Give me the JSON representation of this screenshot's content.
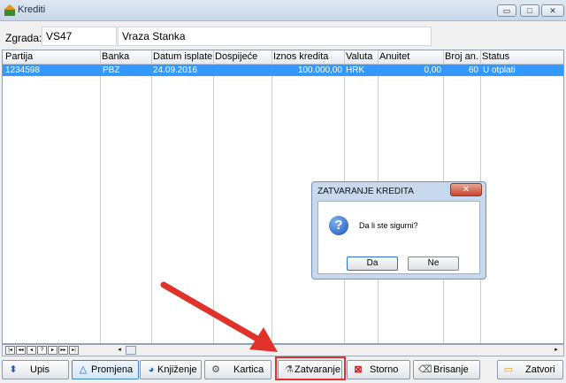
{
  "window": {
    "title": "Krediti",
    "minimize_symbol": "▭",
    "maximize_symbol": "□",
    "close_symbol": "✕"
  },
  "header": {
    "label": "Zgrada:",
    "code": "VS47",
    "name": "Vraza Stanka"
  },
  "grid": {
    "columns": [
      "Partija",
      "Banka",
      "Datum isplate",
      "Dospijeće",
      "Iznos kredita",
      "Valuta",
      "Anuitet",
      "Broj an.",
      "Status"
    ],
    "rows": [
      {
        "partija": "1234598",
        "banka": "PBZ",
        "datum": "24.09.2016",
        "dospijece": "",
        "iznos": "100.000,00",
        "valuta": "HRK",
        "anuitet": "0,00",
        "broj": "60",
        "status": "U otplati"
      }
    ]
  },
  "navigator": {
    "buttons": [
      "|◂",
      "◂◂",
      "◂",
      "?",
      "▸",
      "▸▸",
      "▸|"
    ],
    "scroll_left": "◂",
    "scroll_right": "▸"
  },
  "toolbar": {
    "upis": "Upis",
    "promjena": "Promjena",
    "knjizenje": "Knjiženje",
    "kartica": "Kartica",
    "zatvaranje": "Zatvaranje",
    "storno": "Storno",
    "brisanje": "Brisanje",
    "zatvori": "Zatvori"
  },
  "dialog": {
    "title": "ZATVARANJE KREDITA",
    "message": "Da li ste sigurni?",
    "yes_label": "Da",
    "no_label": "Ne",
    "close_symbol": "✕",
    "icon_glyph": "?"
  },
  "annotation_color": "#e0312b"
}
